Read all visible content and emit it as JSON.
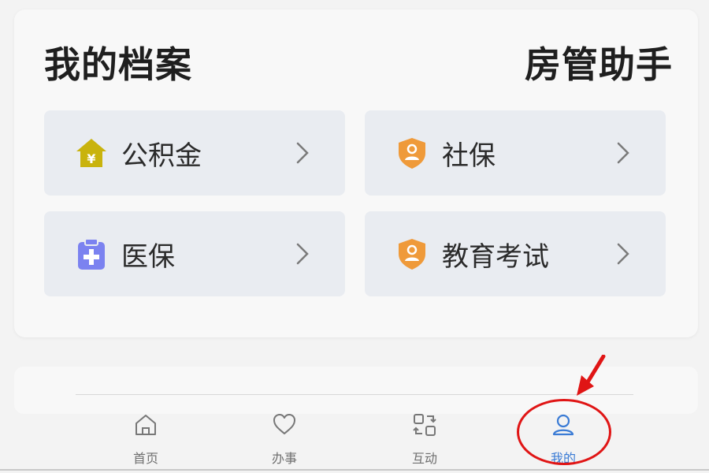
{
  "card": {
    "title": "我的档案"
  },
  "overlay": {
    "title": "房管助手"
  },
  "tiles": [
    {
      "label": "公积金",
      "icon": "house-yuan-icon",
      "color": "#c9b30d"
    },
    {
      "label": "社保",
      "icon": "shield-person-icon",
      "color": "#ef9a3a"
    },
    {
      "label": "医保",
      "icon": "medical-clipboard-icon",
      "color": "#7b82f0"
    },
    {
      "label": "教育考试",
      "icon": "shield-person-icon",
      "color": "#ef9a3a"
    }
  ],
  "tabbar": {
    "tabs": [
      {
        "label": "首页",
        "icon": "home-icon"
      },
      {
        "label": "办事",
        "icon": "heart-icon"
      },
      {
        "label": "互动",
        "icon": "exchange-icon"
      },
      {
        "label": "我的",
        "icon": "user-icon",
        "active": true
      }
    ]
  },
  "colors": {
    "accent": "#3a7bd5",
    "annotation": "#e01515"
  }
}
